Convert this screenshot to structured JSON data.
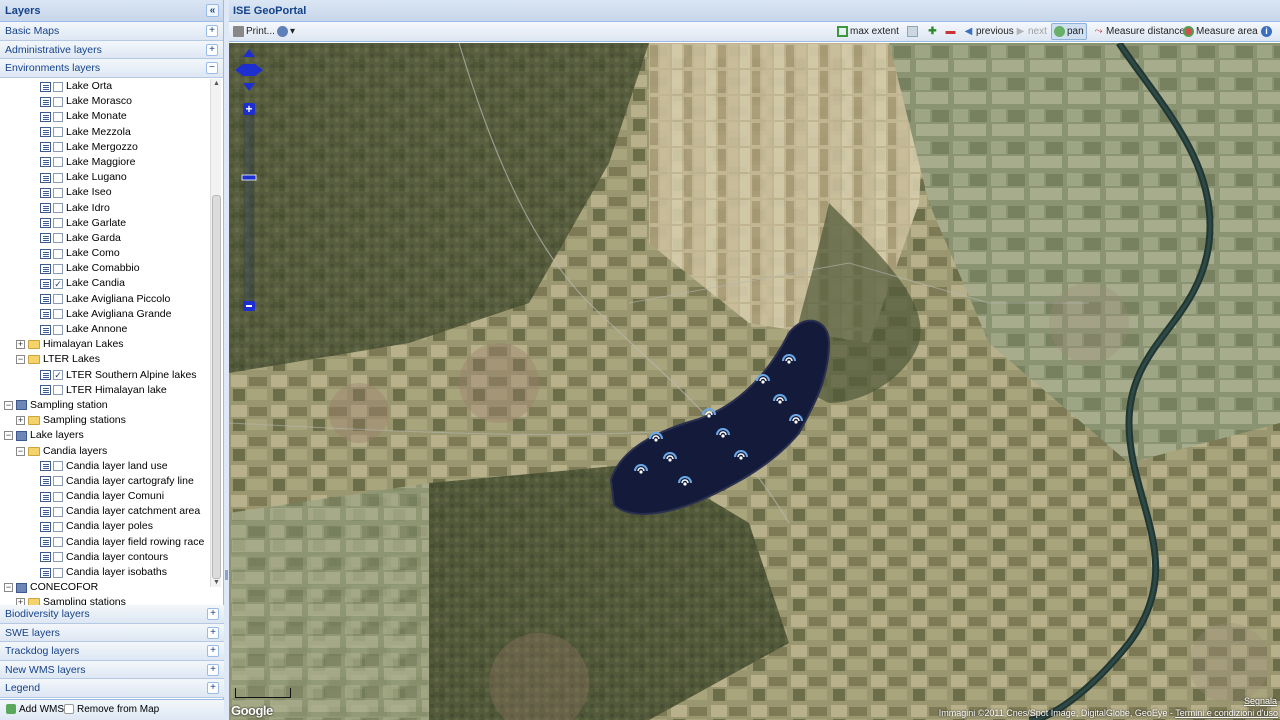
{
  "left_panel": {
    "title": "Layers",
    "collapse_glyph": "«",
    "accordions_top": [
      {
        "label": "Basic Maps",
        "state": "+"
      },
      {
        "label": "Administrative layers",
        "state": "+"
      },
      {
        "label": "Environments layers",
        "state": "−"
      }
    ],
    "tree": [
      {
        "depth": 3,
        "kind": "layer",
        "checked": false,
        "label": "Lake Orta"
      },
      {
        "depth": 3,
        "kind": "layer",
        "checked": false,
        "label": "Lake Morasco"
      },
      {
        "depth": 3,
        "kind": "layer",
        "checked": false,
        "label": "Lake Monate"
      },
      {
        "depth": 3,
        "kind": "layer",
        "checked": false,
        "label": "Lake Mezzola"
      },
      {
        "depth": 3,
        "kind": "layer",
        "checked": false,
        "label": "Lake Mergozzo"
      },
      {
        "depth": 3,
        "kind": "layer",
        "checked": false,
        "label": "Lake Maggiore"
      },
      {
        "depth": 3,
        "kind": "layer",
        "checked": false,
        "label": "Lake Lugano"
      },
      {
        "depth": 3,
        "kind": "layer",
        "checked": false,
        "label": "Lake Iseo"
      },
      {
        "depth": 3,
        "kind": "layer",
        "checked": false,
        "label": "Lake Idro"
      },
      {
        "depth": 3,
        "kind": "layer",
        "checked": false,
        "label": "Lake Garlate"
      },
      {
        "depth": 3,
        "kind": "layer",
        "checked": false,
        "label": "Lake Garda"
      },
      {
        "depth": 3,
        "kind": "layer",
        "checked": false,
        "label": "Lake Como"
      },
      {
        "depth": 3,
        "kind": "layer",
        "checked": false,
        "label": "Lake Comabbio"
      },
      {
        "depth": 3,
        "kind": "layer",
        "checked": true,
        "label": "Lake Candia"
      },
      {
        "depth": 3,
        "kind": "layer",
        "checked": false,
        "label": "Lake Avigliana Piccolo"
      },
      {
        "depth": 3,
        "kind": "layer",
        "checked": false,
        "label": "Lake Avigliana Grande"
      },
      {
        "depth": 3,
        "kind": "layer",
        "checked": false,
        "label": "Lake Annone"
      },
      {
        "depth": 1,
        "kind": "folder",
        "expander": "+",
        "label": "Himalayan Lakes"
      },
      {
        "depth": 1,
        "kind": "folder",
        "expander": "−",
        "label": "LTER Lakes"
      },
      {
        "depth": 3,
        "kind": "layer",
        "checked": true,
        "label": "LTER Southern Alpine lakes"
      },
      {
        "depth": 3,
        "kind": "layer",
        "checked": false,
        "label": "LTER Himalayan lake"
      },
      {
        "depth": 0,
        "kind": "group",
        "expander": "−",
        "label": "Sampling station"
      },
      {
        "depth": 1,
        "kind": "folder",
        "expander": "+",
        "label": "Sampling stations"
      },
      {
        "depth": 0,
        "kind": "group",
        "expander": "−",
        "label": "Lake layers"
      },
      {
        "depth": 1,
        "kind": "folder",
        "expander": "−",
        "label": "Candia layers"
      },
      {
        "depth": 3,
        "kind": "layer",
        "checked": false,
        "label": "Candia layer land use"
      },
      {
        "depth": 3,
        "kind": "layer",
        "checked": false,
        "label": "Candia layer cartografy line"
      },
      {
        "depth": 3,
        "kind": "layer",
        "checked": false,
        "label": "Candia layer Comuni"
      },
      {
        "depth": 3,
        "kind": "layer",
        "checked": false,
        "label": "Candia layer catchment area"
      },
      {
        "depth": 3,
        "kind": "layer",
        "checked": false,
        "label": "Candia layer poles"
      },
      {
        "depth": 3,
        "kind": "layer",
        "checked": false,
        "label": "Candia layer field rowing race"
      },
      {
        "depth": 3,
        "kind": "layer",
        "checked": false,
        "label": "Candia layer contours"
      },
      {
        "depth": 3,
        "kind": "layer",
        "checked": false,
        "label": "Candia layer isobaths"
      },
      {
        "depth": 0,
        "kind": "group",
        "expander": "−",
        "label": "CONECOFOR"
      },
      {
        "depth": 1,
        "kind": "folder",
        "expander": "+",
        "label": "Sampling stations"
      }
    ],
    "accordions_bottom": [
      {
        "label": "Biodiversity layers",
        "state": "+"
      },
      {
        "label": "SWE layers",
        "state": "+"
      },
      {
        "label": "Trackdog layers",
        "state": "+"
      },
      {
        "label": "New WMS layers",
        "state": "+"
      },
      {
        "label": "Legend",
        "state": "+"
      }
    ],
    "footer": {
      "add_wms": "Add WMS",
      "remove": "Remove from Map"
    }
  },
  "right_panel": {
    "title": "ISE GeoPortal",
    "toolbar": {
      "print": "Print...",
      "max_extent": "max extent",
      "previous": "previous",
      "next": "next",
      "pan": "pan",
      "measure_distance": "Measure distance",
      "measure_area": "Measure area"
    },
    "map": {
      "copyright": "Immagini ©2011 Cnes/Spot Image, DigitalGlobe, GeoEye -",
      "terms": "Termini e condizioni d'uso",
      "map_data_link": "Segnala",
      "logo": "Google",
      "station_marker_count": 12
    }
  },
  "colors": {
    "header_text": "#15428b",
    "border": "#99bbe8",
    "lake": "#151a3c",
    "marker": "#6aa8e8"
  }
}
